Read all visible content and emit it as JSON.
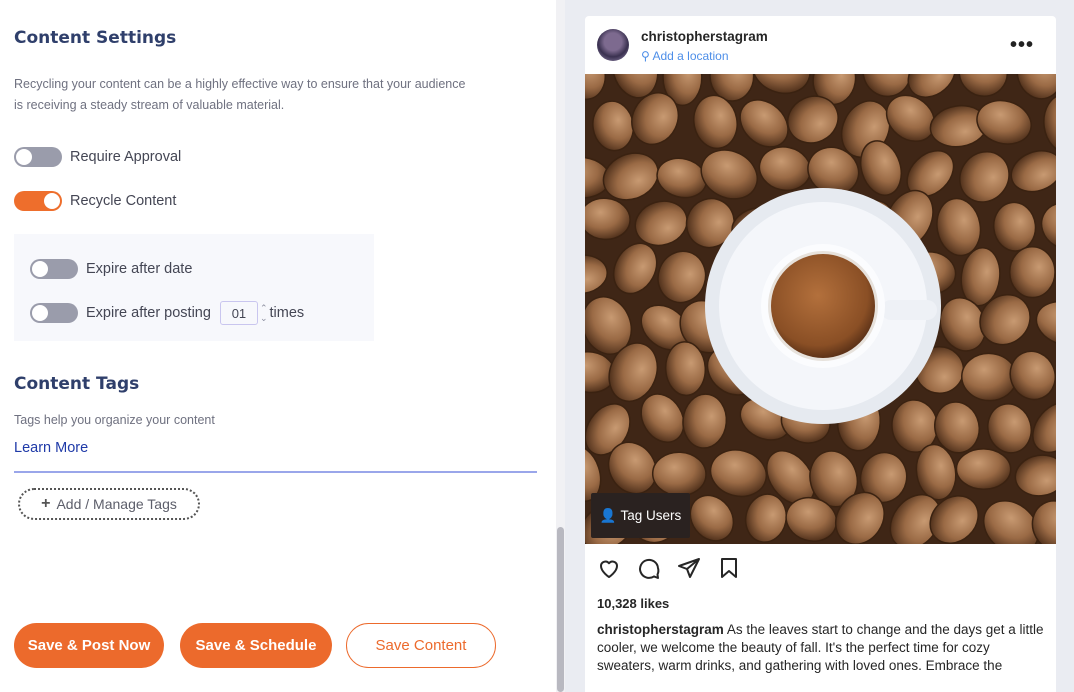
{
  "settings": {
    "title": "Content Settings",
    "description_line1": "Recycling your content can be a highly effective way to ensure that your audience",
    "description_line2": "is receiving a steady stream of valuable material.",
    "require_approval_label": "Require Approval",
    "require_approval_on": false,
    "recycle_content_label": "Recycle Content",
    "recycle_content_on": true,
    "expire_after_date_label": "Expire after date",
    "expire_after_date_on": false,
    "expire_after_posting_label": "Expire after posting",
    "expire_after_posting_on": false,
    "expire_after_posting_count": "01",
    "times_label": "times"
  },
  "tags": {
    "title": "Content Tags",
    "description": "Tags help you organize your content",
    "learn_more": "Learn More",
    "add_manage_label": "Add / Manage Tags"
  },
  "actions": {
    "save_post_now": "Save & Post Now",
    "save_schedule": "Save & Schedule",
    "save_content": "Save Content"
  },
  "preview": {
    "username": "christopherstagram",
    "location_placeholder": "Add a location",
    "more_glyph": "•••",
    "tag_users_label": "Tag Users",
    "likes": "10,328 likes",
    "caption_user": "christopherstagram",
    "caption_text": "As the leaves start to change and the days get a little cooler, we welcome the beauty of fall. It's the perfect time for cozy sweaters, warm drinks, and gathering with loved ones. Embrace the"
  },
  "colors": {
    "accent": "#ec6a2c",
    "heading": "#2f3f6b",
    "link": "#1f3aa8",
    "location_link": "#4d8ee8"
  }
}
